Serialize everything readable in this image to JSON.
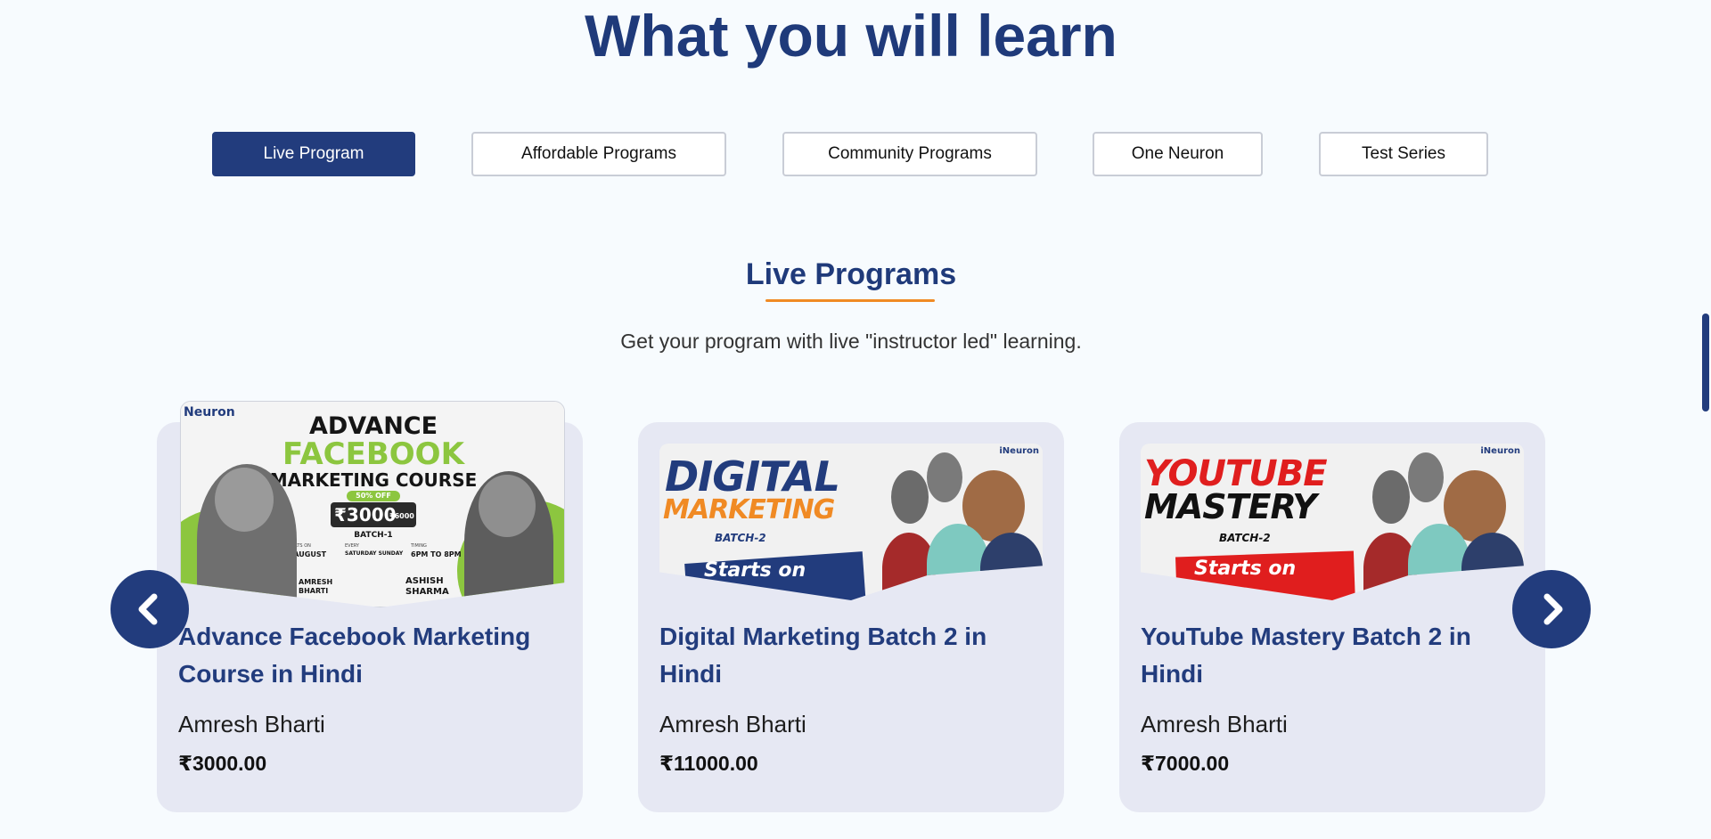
{
  "header": {
    "title": "What you will learn"
  },
  "tabs": [
    {
      "label": "Live Program",
      "active": true
    },
    {
      "label": "Affordable Programs",
      "active": false
    },
    {
      "label": "Community Programs",
      "active": false
    },
    {
      "label": "One Neuron",
      "active": false
    },
    {
      "label": "Test Series",
      "active": false
    }
  ],
  "section": {
    "title": "Live Programs",
    "subtitle": "Get your program with live \"instructor led\" learning."
  },
  "cards": [
    {
      "title": "Advance Facebook Marketing Course in Hindi",
      "author": "Amresh Bharti",
      "price": "₹3000.00",
      "banner": {
        "brand": "Neuron",
        "line1": "ADVANCE",
        "line2": "FACEBOOK",
        "line3": "MARKETING COURSE",
        "offer": "50% OFF",
        "price": "₹3000",
        "old_price": "₹6000",
        "batch": "BATCH-1",
        "starts_label": "STARTS ON",
        "starts": "6 AUGUST",
        "every_label": "EVERY",
        "days": "SATURDAY SUNDAY",
        "timing_label": "TIMING",
        "timing": "6PM TO 8PM",
        "name1": "AMRESH BHARTI",
        "name2": "ASHISH SHARMA"
      }
    },
    {
      "title": "Digital Marketing Batch 2 in Hindi",
      "author": "Amresh Bharti",
      "price": "₹11000.00",
      "banner": {
        "brand": "iNeuron",
        "line1": "DIGITAL",
        "line2": "MARKETING",
        "batch": "BATCH-2",
        "starts": "Starts on"
      }
    },
    {
      "title": "YouTube Mastery Batch 2 in Hindi",
      "author": "Amresh Bharti",
      "price": "₹7000.00",
      "banner": {
        "brand": "iNeuron",
        "line1": "YOUTUBE",
        "line2": "MASTERY",
        "batch": "BATCH-2",
        "starts": "Starts on"
      }
    }
  ],
  "colors": {
    "primary": "#223c7d",
    "accent": "#f08a24",
    "card_bg": "#e6e8f3",
    "page_bg": "#f7fbfe"
  },
  "icons": {
    "prev": "chevron-left-icon",
    "next": "chevron-right-icon"
  }
}
